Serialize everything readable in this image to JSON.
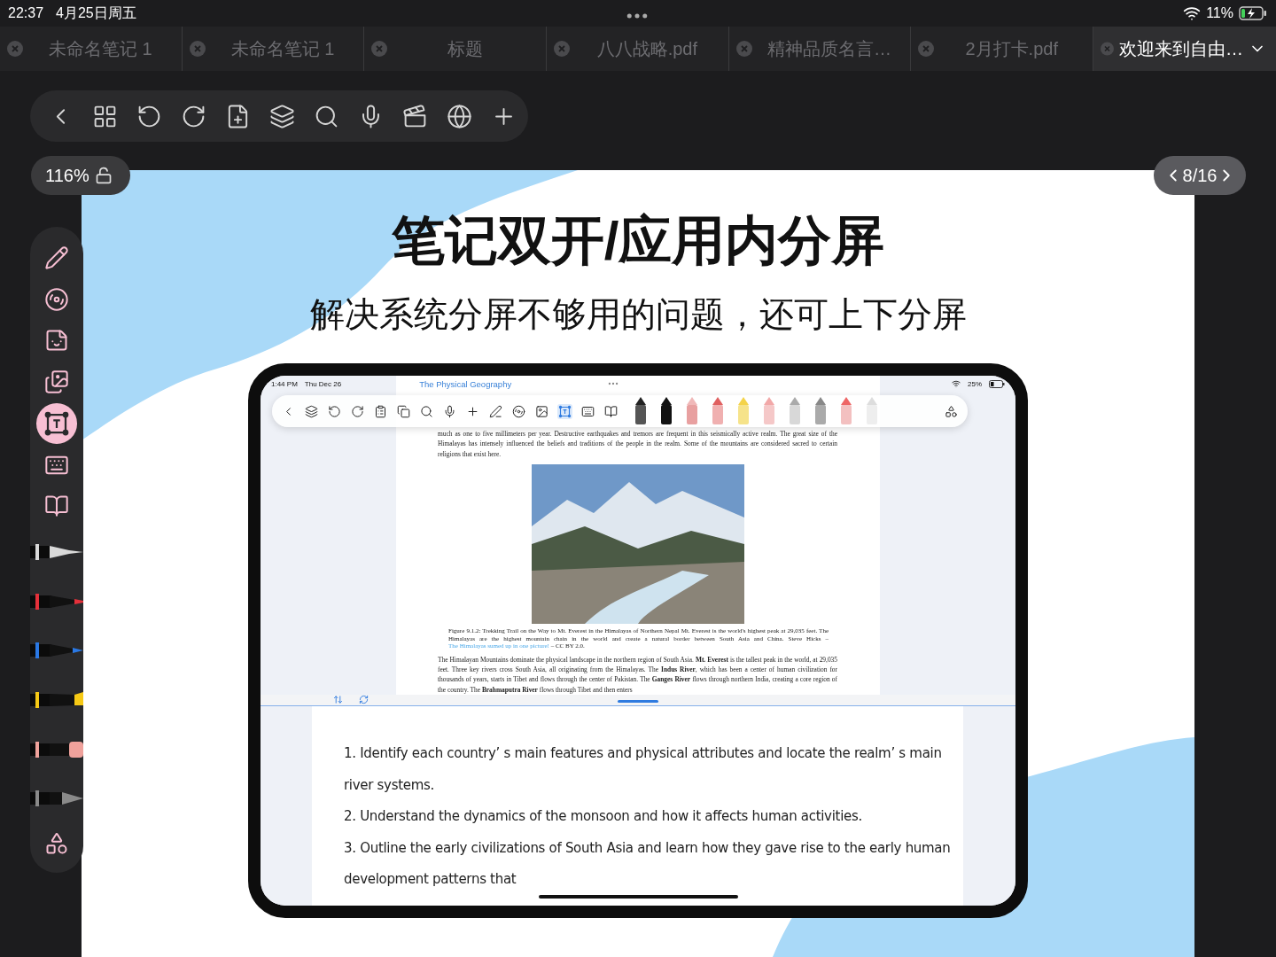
{
  "status_bar": {
    "time": "22:37",
    "date": "4月25日周五",
    "battery": "11%"
  },
  "tabs": [
    {
      "label": "未命名笔记 1",
      "selected": false
    },
    {
      "label": "未命名笔记 1",
      "selected": false
    },
    {
      "label": "标题",
      "selected": false
    },
    {
      "label": "八八战略.pdf",
      "selected": false
    },
    {
      "label": "精神品质名言…",
      "selected": false
    },
    {
      "label": "2月打卡.pdf",
      "selected": false
    },
    {
      "label": "欢迎来到自由…",
      "selected": true
    }
  ],
  "zoom": "116%",
  "page_indicator": "8/16",
  "rail": {
    "tools": [
      {
        "kind": "pencil",
        "selected": false
      },
      {
        "kind": "tape",
        "selected": false
      },
      {
        "kind": "sticker",
        "selected": false
      },
      {
        "kind": "image",
        "selected": false
      },
      {
        "kind": "textbox",
        "selected": true
      },
      {
        "kind": "keyboard",
        "selected": false
      },
      {
        "kind": "book",
        "selected": false
      },
      {
        "kind": "fountain-pen",
        "selected": false,
        "color": "#d9d9d9"
      },
      {
        "kind": "marker",
        "selected": false,
        "color": "#e5303a"
      },
      {
        "kind": "ballpoint",
        "selected": false,
        "color": "#2a78e4"
      },
      {
        "kind": "highlighter",
        "selected": false,
        "color": "#f6c915"
      },
      {
        "kind": "eraser",
        "selected": false,
        "color": "#f0a29c"
      },
      {
        "kind": "pencil-tool",
        "selected": false,
        "color": "#8a8a8a"
      },
      {
        "kind": "shapes",
        "selected": false
      }
    ]
  },
  "slide": {
    "title": "笔记双开/应用内分屏",
    "subtitle": "解决系统分屏不够用的问题，还可上下分屏",
    "tablet": {
      "status": {
        "time": "1:44 PM",
        "date": "Thu Dec 26",
        "document_title": "The Physical Geography",
        "battery": "25%"
      },
      "pdf": {
        "paragraph_1": "much as one to five millimeters per year. Destructive earthquakes and tremors are frequent in this seismically active realm. The great size of the Himalayas has intensely influenced the beliefs and traditions of the people in the realm. Some of the mountains are considered sacred to certain religions that exist here.",
        "caption": "Figure 9.1.2: Trekking Trail on the Way to Mt. Everest in the Himalayas of Northern Nepal Mt. Everest is the world's highest peak at 29,035 feet. The Himalayas are the highest mountain chain in the world and create a natural border between South Asia and China. Steve Hicks –",
        "caption_link": "The Himalayas sumed up in one picture!",
        "caption_license": "– CC BY 2.0.",
        "paragraph_2": "The Himalayan Mountains dominate the physical landscape in the northern region of South Asia. **Mt. Everest** is the tallest peak in the world, at 29,035 feet. Three key rivers cross South Asia, all originating from the Himalayas. The **Indus River**, which has been a center of human civilization for thousands of years, starts in Tibet and flows through the center of Pakistan. The **Ganges River** flows through northern India, creating a core region of the country. The **Brahmaputra River** flows through Tibet and then enters"
      },
      "notes": [
        "1. Identify each country’ s main features and physical attributes and locate the realm’ s main",
        "river systems.",
        "2. Understand the dynamics of the monsoon and how it affects human activities.",
        "3. Outline the early civilizations of South Asia and learn how they gave rise to the early human",
        "development patterns that"
      ]
    }
  }
}
